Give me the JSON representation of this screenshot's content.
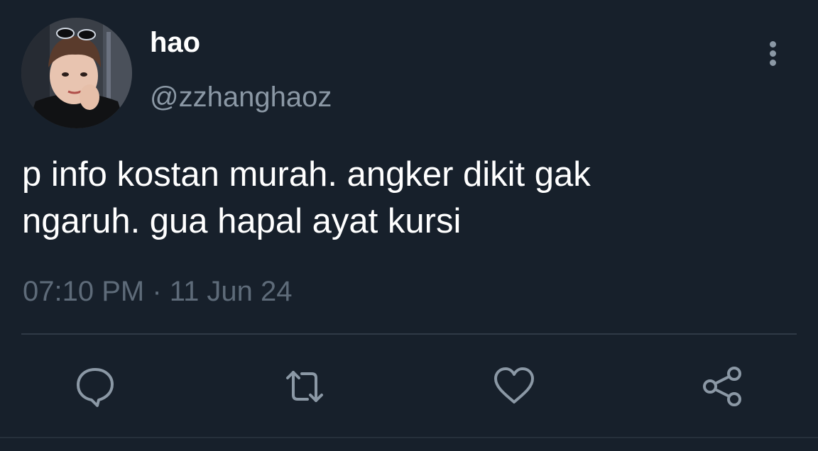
{
  "tweet": {
    "display_name": "hao",
    "handle": "@zzhanghaoz",
    "text_line1": "p info kostan murah. angker dikit gak",
    "text_line2": "ngaruh. gua hapal ayat kursi",
    "time": "07:10 PM",
    "separator": "·",
    "date": "11 Jun 24"
  },
  "icons": {
    "more": "more-vertical-icon",
    "reply": "reply-icon",
    "retweet": "retweet-icon",
    "like": "heart-icon",
    "share": "share-icon"
  },
  "colors": {
    "background": "#17202b",
    "primary_text": "#ffffff",
    "secondary_text": "#8b98a5",
    "timestamp_text": "#5e6b79",
    "icon": "#8b98a5"
  }
}
